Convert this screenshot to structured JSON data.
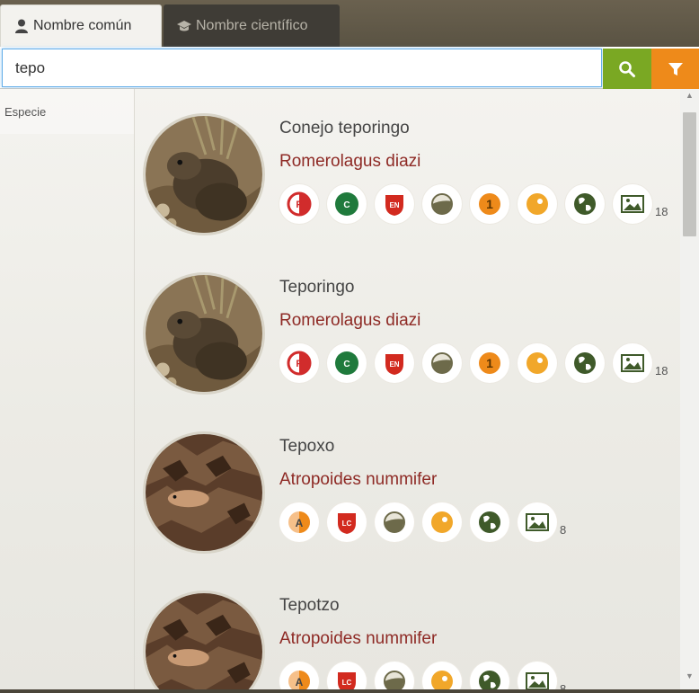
{
  "tabs": {
    "common_label": "Nombre común",
    "scientific_label": "Nombre científico"
  },
  "search": {
    "value": "tepo"
  },
  "sidebar": {
    "header": "Especie"
  },
  "colors": {
    "search_button": "#7aa823",
    "filter_button": "#ee8a1a",
    "scientific_name": "#8e2a25"
  },
  "results": [
    {
      "common_name": "Conejo teporingo",
      "scientific_name": "Romerolagus diazi",
      "badges": [
        "nom-059-icon",
        "cites-icon",
        "iucn-en-icon",
        "distribution-icon",
        "priority-1-icon",
        "endemic-icon",
        "global-map-icon",
        "photos-icon"
      ],
      "photo_count": "18",
      "image": "rabbit"
    },
    {
      "common_name": "Teporingo",
      "scientific_name": "Romerolagus diazi",
      "badges": [
        "nom-059-icon",
        "cites-icon",
        "iucn-en-icon",
        "distribution-icon",
        "priority-1-icon",
        "endemic-icon",
        "global-map-icon",
        "photos-icon"
      ],
      "photo_count": "18",
      "image": "rabbit"
    },
    {
      "common_name": "Tepoxo",
      "scientific_name": "Atropoides nummifer",
      "badges": [
        "nom-059-a-icon",
        "iucn-lc-icon",
        "distribution-icon",
        "endemic-icon",
        "global-map-icon",
        "photos-icon"
      ],
      "photo_count": "8",
      "image": "snake"
    },
    {
      "common_name": "Tepotzo",
      "scientific_name": "Atropoides nummifer",
      "badges": [
        "nom-059-a-icon",
        "iucn-lc-icon",
        "distribution-icon",
        "endemic-icon",
        "global-map-icon",
        "photos-icon"
      ],
      "photo_count": "8",
      "image": "snake"
    }
  ]
}
